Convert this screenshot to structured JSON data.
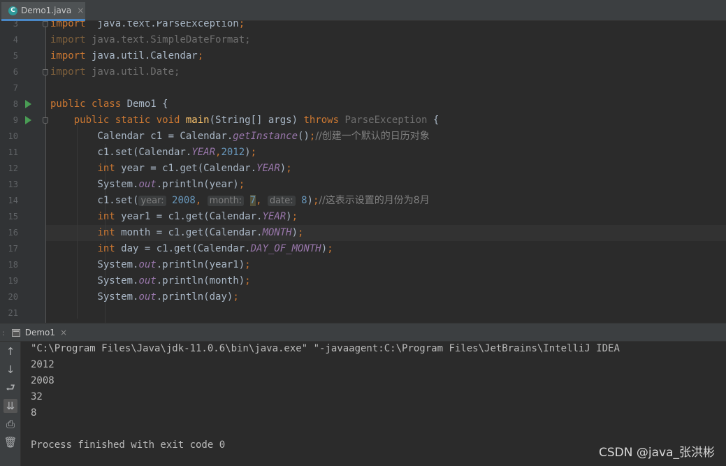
{
  "editor_tab": {
    "filename": "Demo1.java",
    "file_icon": "java-class-icon",
    "close": "×"
  },
  "editor": {
    "line_numbers": [
      "3",
      "4",
      "5",
      "6",
      "7",
      "8",
      "9",
      "10",
      "11",
      "12",
      "13",
      "14",
      "15",
      "16",
      "17",
      "18",
      "19",
      "20",
      "21"
    ],
    "lines": [
      [
        [
          "kw",
          "import"
        ],
        [
          "",
          "  java.text.ParseException"
        ],
        [
          "kw",
          ";"
        ]
      ],
      [
        [
          "kwd",
          "import"
        ],
        [
          "dim",
          " java.text.SimpleDateFormat;"
        ]
      ],
      [
        [
          "kw",
          "import"
        ],
        [
          "",
          " java.util.Calendar"
        ],
        [
          "kw",
          ";"
        ]
      ],
      [
        [
          "kwd",
          "import"
        ],
        [
          "dim",
          " java.util.Date;"
        ]
      ],
      [],
      [
        [
          "kw",
          "public class "
        ],
        [
          "",
          "Demo1 {"
        ]
      ],
      [
        [
          "",
          "    "
        ],
        [
          "kw",
          "public static void "
        ],
        [
          "fn",
          "main"
        ],
        [
          "",
          "(String[] args) "
        ],
        [
          "kw",
          "throws "
        ],
        [
          "dim",
          "ParseException "
        ],
        [
          "",
          "{"
        ]
      ],
      [
        [
          "",
          "        Calendar c1 = Calendar."
        ],
        [
          "st",
          "getInstance"
        ],
        [
          "",
          "()"
        ],
        [
          "kw",
          ";"
        ],
        [
          "cm",
          "//创建一个默认的日历对象"
        ]
      ],
      [
        [
          "",
          "        c1.set(Calendar."
        ],
        [
          "st",
          "YEAR"
        ],
        [
          "kw",
          ","
        ],
        [
          "num",
          "2012"
        ],
        [
          "",
          ")"
        ],
        [
          "kw",
          ";"
        ]
      ],
      [
        [
          "",
          "        "
        ],
        [
          "kw",
          "int "
        ],
        [
          "",
          "year = c1.get(Calendar."
        ],
        [
          "st",
          "YEAR"
        ],
        [
          "",
          ")"
        ],
        [
          "kw",
          ";"
        ]
      ],
      [
        [
          "",
          "        System."
        ],
        [
          "st",
          "out"
        ],
        [
          "",
          ".println(year)"
        ],
        [
          "kw",
          ";"
        ]
      ],
      [
        [
          "",
          "        c1.set("
        ],
        [
          "hint",
          "year:"
        ],
        [
          "",
          " "
        ],
        [
          "num",
          "2008"
        ],
        [
          "kw",
          ", "
        ],
        [
          "hint",
          "month:"
        ],
        [
          "",
          " "
        ],
        [
          "caret",
          "7"
        ],
        [
          "kw",
          ", "
        ],
        [
          "hint",
          "date:"
        ],
        [
          "",
          " "
        ],
        [
          "num",
          "8"
        ],
        [
          "",
          ")"
        ],
        [
          "kw",
          ";"
        ],
        [
          "cm",
          "//这表示设置的月份为8月"
        ]
      ],
      [
        [
          "",
          "        "
        ],
        [
          "kw",
          "int "
        ],
        [
          "",
          "year1 = c1.get(Calendar."
        ],
        [
          "st",
          "YEAR"
        ],
        [
          "",
          ")"
        ],
        [
          "kw",
          ";"
        ]
      ],
      [
        [
          "",
          "        "
        ],
        [
          "kw",
          "int "
        ],
        [
          "",
          "month = c1.get(Calendar."
        ],
        [
          "st",
          "MONTH"
        ],
        [
          "",
          ")"
        ],
        [
          "kw",
          ";"
        ]
      ],
      [
        [
          "",
          "        "
        ],
        [
          "kw",
          "int "
        ],
        [
          "",
          "day = c1.get(Calendar."
        ],
        [
          "st",
          "DAY_OF_MONTH"
        ],
        [
          "",
          ")"
        ],
        [
          "kw",
          ";"
        ]
      ],
      [
        [
          "",
          "        System."
        ],
        [
          "st",
          "out"
        ],
        [
          "",
          ".println(year1)"
        ],
        [
          "kw",
          ";"
        ]
      ],
      [
        [
          "",
          "        System."
        ],
        [
          "st",
          "out"
        ],
        [
          "",
          ".println(month)"
        ],
        [
          "kw",
          ";"
        ]
      ],
      [
        [
          "",
          "        System."
        ],
        [
          "st",
          "out"
        ],
        [
          "",
          ".println(day)"
        ],
        [
          "kw",
          ";"
        ]
      ],
      []
    ],
    "run_marker_lines": [
      "8",
      "9"
    ],
    "colors": {
      "keyword": "#cc7832",
      "string_static": "#9876aa",
      "number": "#6897bb",
      "method": "#ffc66d",
      "text": "#a9b7c6",
      "comment": "#808080"
    }
  },
  "run_window": {
    "tab_label": "Demo1",
    "tab_close": "×",
    "toolbar_icons": [
      "arrow-up-icon",
      "arrow-down-icon",
      "soft-wrap-icon",
      "scroll-to-end-icon",
      "print-icon",
      "trash-icon"
    ],
    "output": [
      "\"C:\\Program Files\\Java\\jdk-11.0.6\\bin\\java.exe\" \"-javaagent:C:\\Program Files\\JetBrains\\IntelliJ IDEA",
      "2012",
      "2008",
      "32",
      "8",
      "",
      "Process finished with exit code 0"
    ]
  },
  "watermark": "CSDN @java_张洪彬"
}
